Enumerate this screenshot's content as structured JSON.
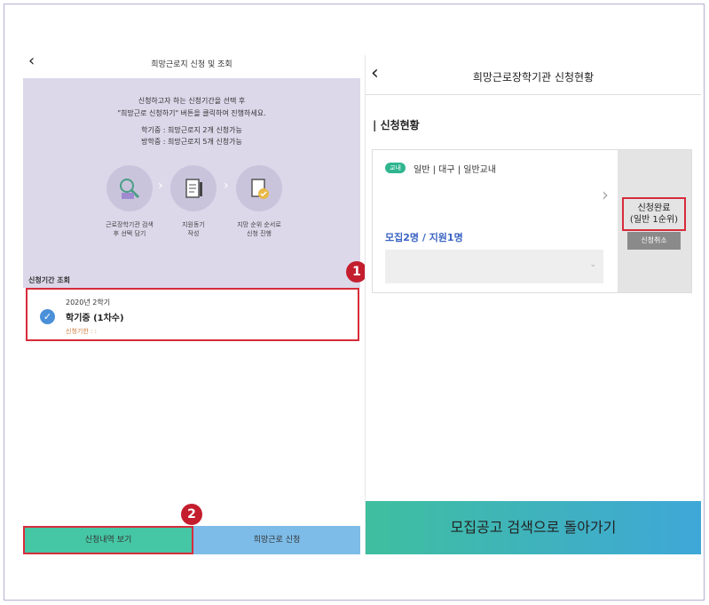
{
  "left": {
    "back_icon": "‹",
    "title": "희망근로지 신청 및 조회",
    "intro": {
      "line1": "신청하고자 하는 신청기간을 선택 후",
      "line2": "\"희망근로 신청하기\" 버튼을 클릭하여 진행하세요.",
      "line3": "학기중 : 희망근로지 2개 신청가능",
      "line4": "방학중 : 희망근로지 5개 신청가능"
    },
    "steps": [
      {
        "label1": "근로장학기관 검색",
        "label2": "후 선택 담기"
      },
      {
        "label1": "지원동기",
        "label2": "작성"
      },
      {
        "label1": "지망 순위 순서로",
        "label2": "신청 진행"
      }
    ],
    "step_arrow": "›",
    "section_title": "신청기간 조회",
    "period": {
      "year": "2020년 2학기",
      "term": "학기중 (1차수)",
      "deadline": "신청기한 : :",
      "check_icon": "✓"
    },
    "badge1": "1",
    "badge2": "2",
    "btn_history": "신청내역 보기",
    "btn_apply": "희망근로 신청"
  },
  "right": {
    "back_icon": "‹",
    "title": "희망근로장학기관 신청현황",
    "status_heading": "신청현황",
    "card": {
      "tag": "교내",
      "category": "일반 | 대구 | 일반교내",
      "chevron": "›",
      "quota": "모집2명 / 지원1명",
      "dropdown_icon": "⌄",
      "done_line1": "신청완료",
      "done_line2": "(일반 1순위)",
      "cancel": "신청취소"
    },
    "back_search": "모집공고 검색으로 돌아가기"
  },
  "colors": {
    "accent_red": "#d62c3b",
    "teal": "#45c6a4",
    "blue": "#7dbce8",
    "panel": "#dcd8ea"
  }
}
